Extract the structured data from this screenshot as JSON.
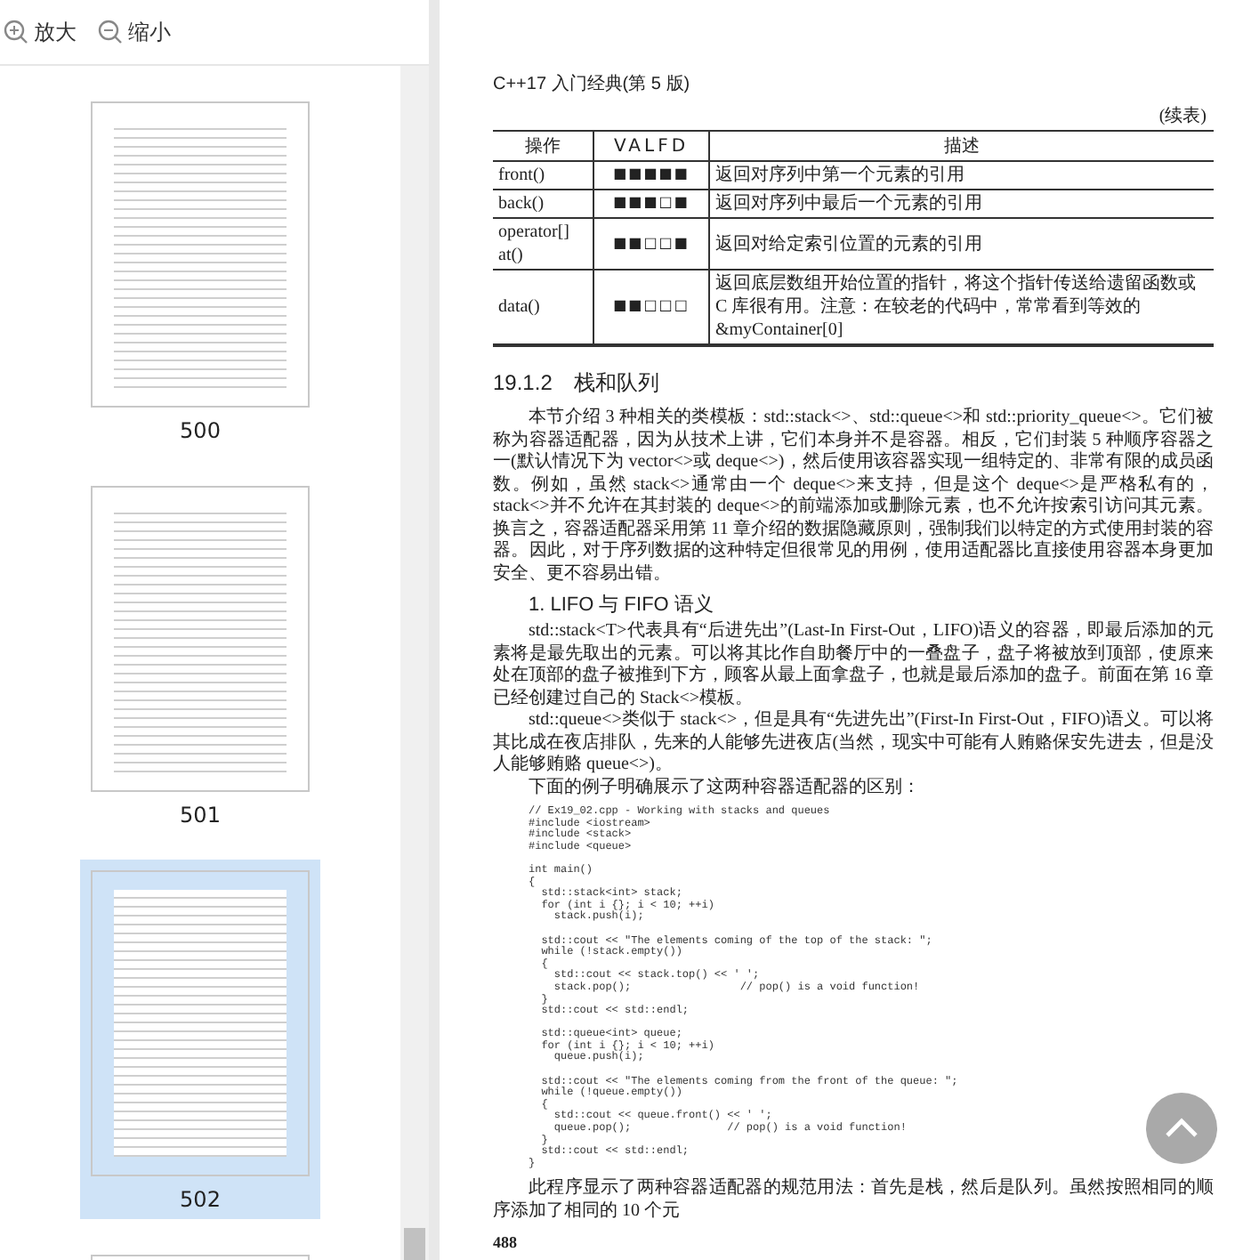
{
  "toolbar": {
    "buttons": [
      {
        "kind": "zoom-in",
        "label": "放大"
      },
      {
        "kind": "zoom-out",
        "label": "缩小"
      }
    ]
  },
  "thumbnails": [
    {
      "label": "500",
      "selected": false
    },
    {
      "label": "501",
      "selected": false
    },
    {
      "label": "502",
      "selected": true
    },
    {
      "selected": false
    }
  ],
  "page": {
    "header": "C++17 入门经典(第 5 版)",
    "table_note": "(续表)",
    "table": {
      "columns": [
        "操作",
        "VALFD",
        "描述"
      ],
      "rows": [
        {
          "operation": [
            "front()"
          ],
          "marks": "■■■■■",
          "description": "返回对序列中第一个元素的引用"
        },
        {
          "operation": [
            "back()"
          ],
          "marks": "■■■□■",
          "description": "返回对序列中最后一个元素的引用"
        },
        {
          "operation": [
            "operator[]",
            "at()"
          ],
          "marks": "■■□□■",
          "description": "返回对给定索引位置的元素的引用"
        },
        {
          "operation": [
            "data()"
          ],
          "marks": "■■□□□",
          "description": "返回底层数组开始位置的指针，将这个指针传送给遗留函数或 C 库很有用。注意：在较老的代码中，常常看到等效的&myContainer[0]"
        }
      ]
    },
    "section_heading": "19.1.2　栈和队列",
    "paragraphs": [
      "本节介绍 3 种相关的类模板：std::stack<>、std::queue<>和 std::priority_queue<>。它们被称为容器适配器，因为从技术上讲，它们本身并不是容器。相反，它们封装 5 种顺序容器之一(默认情况下为 vector<>或 deque<>)，然后使用该容器实现一组特定的、非常有限的成员函数。例如，虽然 stack<>通常由一个 deque<>来支持，但是这个 deque<>是严格私有的，stack<>并不允许在其封装的 deque<>的前端添加或删除元素，也不允许按索引访问其元素。换言之，容器适配器采用第 11 章介绍的数据隐藏原则，强制我们以特定的方式使用封装的容器。因此，对于序列数据的这种特定但很常见的用例，使用适配器比直接使用容器本身更加安全、更不容易出错。"
    ],
    "subheading": "1. LIFO 与 FIFO 语义",
    "paragraphs_2": [
      "std::stack<T>代表具有“后进先出”(Last-In First-Out，LIFO)语义的容器，即最后添加的元素将是最先取出的元素。可以将其比作自助餐厅中的一叠盘子，盘子将被放到顶部，使原来处在顶部的盘子被推到下方，顾客从最上面拿盘子，也就是最后添加的盘子。前面在第 16 章已经创建过自己的 Stack<>模板。",
      "std::queue<>类似于 stack<>，但是具有“先进先出”(First-In First-Out，FIFO)语义。可以将其比成在夜店排队，先来的人能够先进夜店(当然，现实中可能有人贿赂保安先进去，但是没人能够贿赂 queue<>)。",
      "下面的例子明确展示了这两种容器适配器的区别："
    ],
    "code_blocks": [
      [
        "// Ex19_02.cpp - Working with stacks and queues",
        "#include <iostream>",
        "#include <stack>",
        "#include <queue>"
      ],
      [
        "int main()",
        "{",
        "  std::stack<int> stack;",
        "  for (int i {}; i < 10; ++i)",
        "    stack.push(i);"
      ],
      [
        "  std::cout << \"The elements coming of the top of the stack: \";",
        "  while (!stack.empty())",
        "  {",
        "    std::cout << stack.top() << ' ';",
        "    stack.pop();                 // pop() is a void function!",
        "  }",
        "  std::cout << std::endl;"
      ],
      [
        "  std::queue<int> queue;",
        "  for (int i {}; i < 10; ++i)",
        "    queue.push(i);"
      ],
      [
        "  std::cout << \"The elements coming from the front of the queue: \";",
        "  while (!queue.empty())",
        "  {",
        "    std::cout << queue.front() << ' ';",
        "    queue.pop();               // pop() is a void function!",
        "  }",
        "  std::cout << std::endl;",
        "}"
      ]
    ],
    "closing": "此程序显示了两种容器适配器的规范用法：首先是栈，然后是队列。虽然按照相同的顺序添加了相同的 10 个元",
    "page_number": "488"
  }
}
